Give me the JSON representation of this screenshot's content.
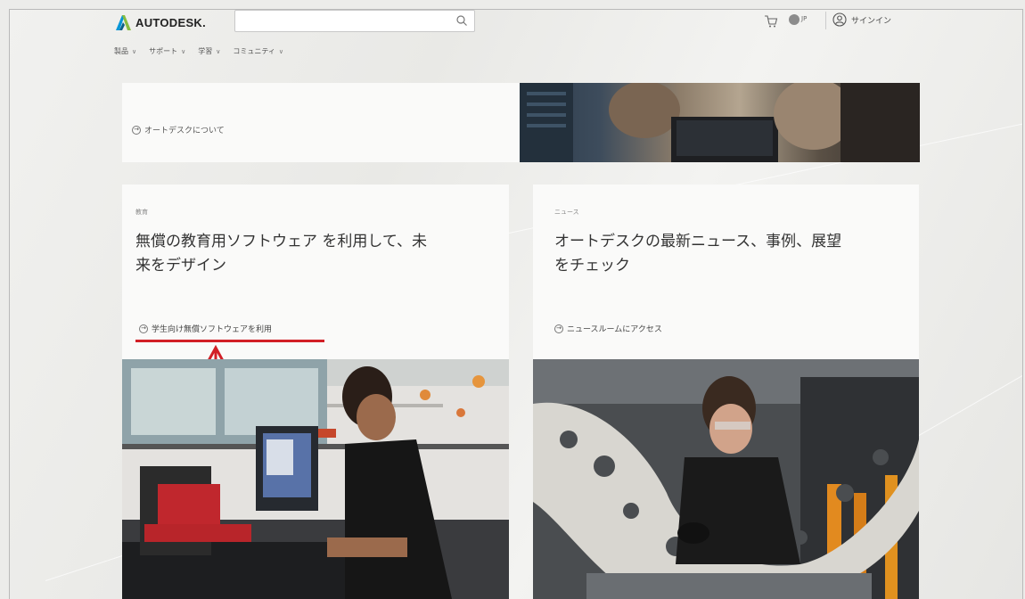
{
  "header": {
    "brand": "AUTODESK.",
    "search": {
      "placeholder": "",
      "icon": "search-icon"
    },
    "cart_icon": "cart-icon",
    "language": "JP",
    "sign_in": "サインイン"
  },
  "nav": {
    "items": [
      {
        "label": "製品"
      },
      {
        "label": "サポート"
      },
      {
        "label": "学習"
      },
      {
        "label": "コミュニティ"
      }
    ]
  },
  "about": {
    "link": "オートデスクについて"
  },
  "education": {
    "eyebrow": "教育",
    "headline_line1": "無償の教育用ソフトウェア を利用して、未",
    "headline_line2": "来をデザイン",
    "cta": "学生向け無償ソフトウェアを利用"
  },
  "news": {
    "eyebrow": "ニュース",
    "headline_line1": "オートデスクの最新ニュース、事例、展望",
    "headline_line2": "をチェック",
    "cta": "ニュースルームにアクセス"
  },
  "colors": {
    "accent": "#d21f26",
    "brand_teal": "#0696d7",
    "brand_green": "#87bc40"
  }
}
